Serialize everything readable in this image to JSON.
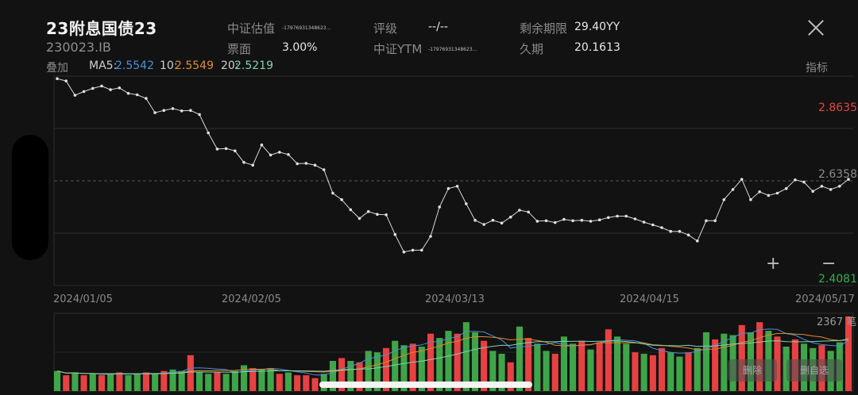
{
  "header": {
    "title": "23附息国债23",
    "code": "230023.IB",
    "csi_valuation_label": "中证估值",
    "csi_valuation_value": "-17976931348623...",
    "coupon_label": "票面",
    "coupon_value": "3.00%",
    "rating_label": "评级",
    "rating_value": "--/--",
    "csi_ytm_label": "中证YTM",
    "csi_ytm_value": "-17976931348623...",
    "remaining_label": "剩余期限",
    "remaining_value": "29.40YY",
    "duration_label": "久期",
    "duration_value": "20.1613"
  },
  "toolbar": {
    "overlay_label": "叠加",
    "indicator_label": "指标",
    "ma5_label": "MA5:",
    "ma5_value": "2.5542",
    "ma10_label": "10:",
    "ma10_value": "2.5549",
    "ma20_label": "20:",
    "ma20_value": "2.5219"
  },
  "colors": {
    "ma5": "#4a90d9",
    "ma10": "#e08a2e",
    "ma20": "#7fd4b0",
    "up": "#e84141",
    "down": "#3fa548",
    "high": "#e84141",
    "low": "#2ab24b"
  },
  "price_labels": {
    "high": "2.8635",
    "mid": "2.6358",
    "low": "2.4081"
  },
  "volume_label": "2367 笔",
  "x_dates": [
    "2024/01/05",
    "2024/02/05",
    "2024/03/13",
    "2024/04/15",
    "2024/05/17"
  ],
  "zoom": {
    "in": "+",
    "out": "−"
  },
  "buttons": {
    "left": "删除",
    "right": "删自选"
  },
  "chart_data": {
    "type": "line",
    "ylim": [
      2.4081,
      2.8635
    ],
    "grid": true,
    "price": [
      2.858,
      2.853,
      2.822,
      2.83,
      2.837,
      2.842,
      2.834,
      2.838,
      2.826,
      2.823,
      2.815,
      2.784,
      2.789,
      2.793,
      2.788,
      2.789,
      2.78,
      2.74,
      2.705,
      2.706,
      2.701,
      2.676,
      2.67,
      2.714,
      2.692,
      2.698,
      2.693,
      2.673,
      2.674,
      2.67,
      2.66,
      2.609,
      2.595,
      2.573,
      2.554,
      2.569,
      2.563,
      2.562,
      2.519,
      2.481,
      2.485,
      2.485,
      2.515,
      2.579,
      2.619,
      2.624,
      2.586,
      2.55,
      2.541,
      2.55,
      2.544,
      2.557,
      2.572,
      2.568,
      2.548,
      2.549,
      2.545,
      2.552,
      2.549,
      2.55,
      2.548,
      2.551,
      2.556,
      2.559,
      2.559,
      2.553,
      2.546,
      2.54,
      2.534,
      2.526,
      2.526,
      2.518,
      2.505,
      2.549,
      2.549,
      2.595,
      2.617,
      2.639,
      2.595,
      2.612,
      2.604,
      2.609,
      2.619,
      2.638,
      2.633,
      2.613,
      2.624,
      2.617,
      2.624,
      2.639
    ],
    "volume": [
      14,
      11,
      13,
      11,
      12,
      11,
      12,
      13,
      11,
      12,
      13,
      12,
      14,
      15,
      14,
      25,
      13,
      12,
      13,
      12,
      14,
      18,
      16,
      15,
      16,
      12,
      13,
      11,
      11,
      9,
      12,
      21,
      23,
      21,
      20,
      28,
      27,
      30,
      35,
      32,
      33,
      31,
      40,
      37,
      42,
      40,
      48,
      41,
      35,
      28,
      26,
      20,
      45,
      37,
      33,
      28,
      26,
      38,
      33,
      35,
      29,
      34,
      43,
      38,
      33,
      27,
      26,
      25,
      30,
      27,
      24,
      27,
      30,
      41,
      36,
      40,
      39,
      46,
      41,
      48,
      42,
      38,
      31,
      36,
      33,
      30,
      32,
      28,
      34,
      52
    ],
    "up_bars": [
      false,
      true,
      false,
      true,
      false,
      true,
      false,
      true,
      false,
      false,
      true,
      false,
      true,
      false,
      false,
      true,
      false,
      false,
      true,
      false,
      false,
      false,
      true,
      false,
      false,
      true,
      false,
      true,
      true,
      true,
      false,
      false,
      true,
      false,
      true,
      false,
      false,
      true,
      false,
      false,
      true,
      false,
      true,
      false,
      false,
      true,
      false,
      false,
      true,
      false,
      false,
      true,
      false,
      true,
      false,
      false,
      true,
      false,
      false,
      true,
      false,
      true,
      true,
      false,
      false,
      true,
      false,
      true,
      true,
      false,
      false,
      true,
      false,
      false,
      true,
      false,
      false,
      true,
      false,
      true,
      false,
      true,
      false,
      true,
      false,
      false,
      true,
      false,
      false,
      true
    ]
  }
}
